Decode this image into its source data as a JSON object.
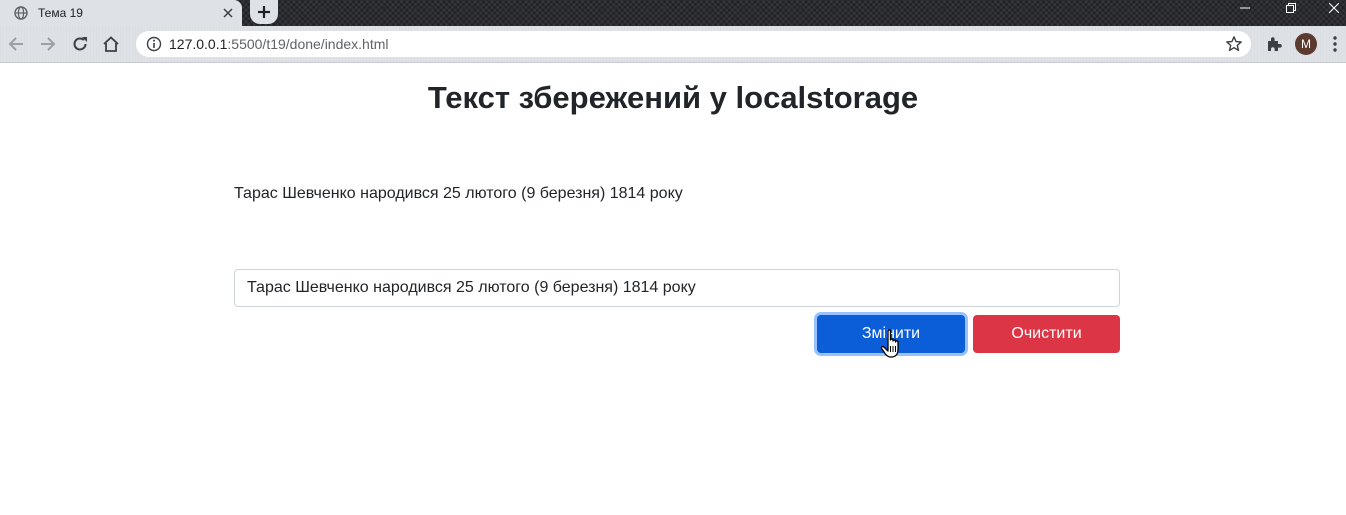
{
  "browser": {
    "tab_title": "Тема 19",
    "url_host": "127.0.0.1",
    "url_path": ":5500/t19/done/index.html",
    "avatar_letter": "M"
  },
  "page": {
    "title": "Текст збережений у localstorage",
    "saved_text": "Тарас Шевченко народився 25 лютого (9 березня) 1814 року",
    "input_value": "Тарас Шевченко народився 25 лютого (9 березня) 1814 року",
    "change_button_label": "Змінити",
    "clear_button_label": "Очистити"
  },
  "colors": {
    "primary": "#0b5ed7",
    "danger": "#dc3545",
    "text": "#212529"
  }
}
